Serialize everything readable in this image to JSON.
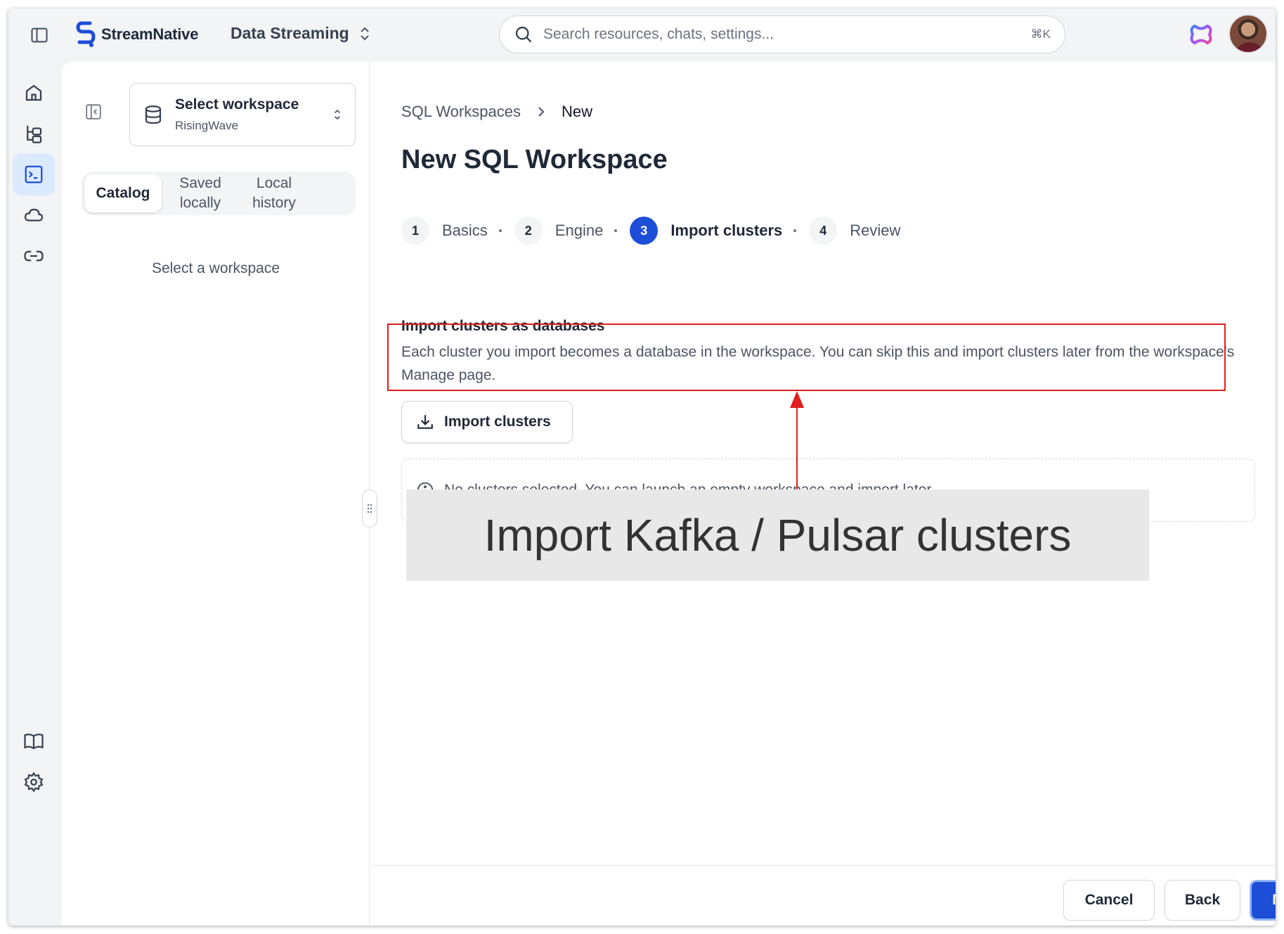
{
  "app": {
    "brand": "StreamNative",
    "org_name": "Data Streaming"
  },
  "search": {
    "placeholder": "Search resources, chats, settings...",
    "shortcut": "⌘K"
  },
  "rail": {
    "items": [
      {
        "name": "home",
        "icon": "home-icon"
      },
      {
        "name": "resources",
        "icon": "tree-icon"
      },
      {
        "name": "sql-workspaces",
        "icon": "terminal-icon",
        "active": true
      },
      {
        "name": "cloud",
        "icon": "cloud-icon"
      },
      {
        "name": "connections",
        "icon": "link-icon"
      },
      {
        "name": "docs",
        "icon": "book-icon"
      },
      {
        "name": "settings",
        "icon": "gear-icon"
      }
    ]
  },
  "sidebar": {
    "workspace_select": {
      "title": "Select workspace",
      "subtitle": "RisingWave"
    },
    "tabs": [
      {
        "label": "Catalog",
        "active": true
      },
      {
        "label": "Saved\nlocally",
        "active": false
      },
      {
        "label": "Local\nhistory",
        "active": false
      }
    ],
    "empty_text": "Select a workspace"
  },
  "breadcrumb": {
    "parent": "SQL Workspaces",
    "current": "New"
  },
  "page": {
    "title": "New SQL Workspace"
  },
  "steps": [
    {
      "num": "1",
      "label": "Basics",
      "active": false
    },
    {
      "num": "2",
      "label": "Engine",
      "active": false
    },
    {
      "num": "3",
      "label": "Import clusters",
      "active": true
    },
    {
      "num": "4",
      "label": "Review",
      "active": false
    }
  ],
  "section": {
    "title": "Import clusters as databases",
    "description": "Each cluster you import becomes a database in the workspace. You can skip this and import clusters later from the workspace's Manage page.",
    "import_button": "Import clusters",
    "notice": "No clusters selected. You can launch an empty workspace and import later."
  },
  "footer": {
    "cancel": "Cancel",
    "back": "Back",
    "next": "Next"
  },
  "annotation": {
    "label": "Import Kafka / Pulsar clusters",
    "color": "#e11d1d"
  },
  "colors": {
    "accent": "#1d4ed8",
    "active_rail_bg": "#dbeafe"
  }
}
